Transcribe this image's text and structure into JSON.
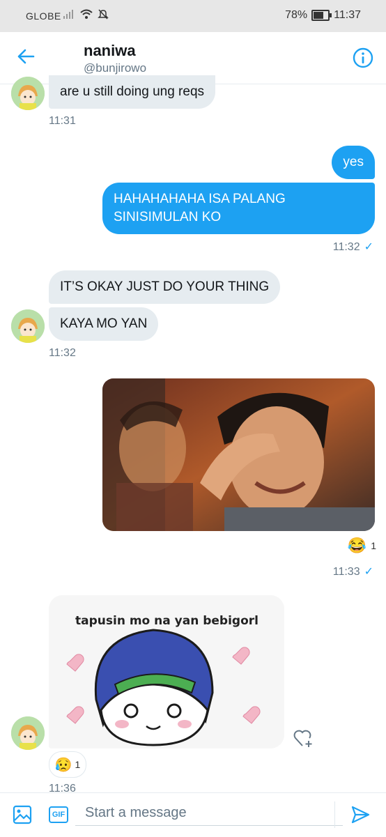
{
  "statusbar": {
    "carrier": "GLOBE",
    "battery": "78%",
    "battery_level": 0.78,
    "time": "11:37"
  },
  "header": {
    "name": "naniwa",
    "handle": "@bunjirowo",
    "back_icon": "arrow-left-icon",
    "info_icon": "info-icon"
  },
  "messages": {
    "m1": {
      "text": "are u still doing ung reqs",
      "time": "11:31"
    },
    "m2": {
      "text": "yes"
    },
    "m3": {
      "text": "HAHAHAHAHA ISA PALANG SINISIMULAN KO",
      "time": "11:32"
    },
    "m4": {
      "text": "IT’S OKAY JUST DO YOUR THING"
    },
    "m5": {
      "text": "KAYA MO YAN",
      "time": "11:32"
    },
    "m6": {
      "reaction_count": "1",
      "time": "11:33"
    },
    "m7": {
      "handwriting": "tapusin mo na yan bebigorl",
      "reaction_count": "1",
      "time": "11:36"
    }
  },
  "composer": {
    "placeholder": "Start a message",
    "gif_label": "GIF"
  },
  "colors": {
    "accent": "#1da1f2",
    "incoming_bubble": "#e6ecf0",
    "secondary_text": "#657786"
  }
}
